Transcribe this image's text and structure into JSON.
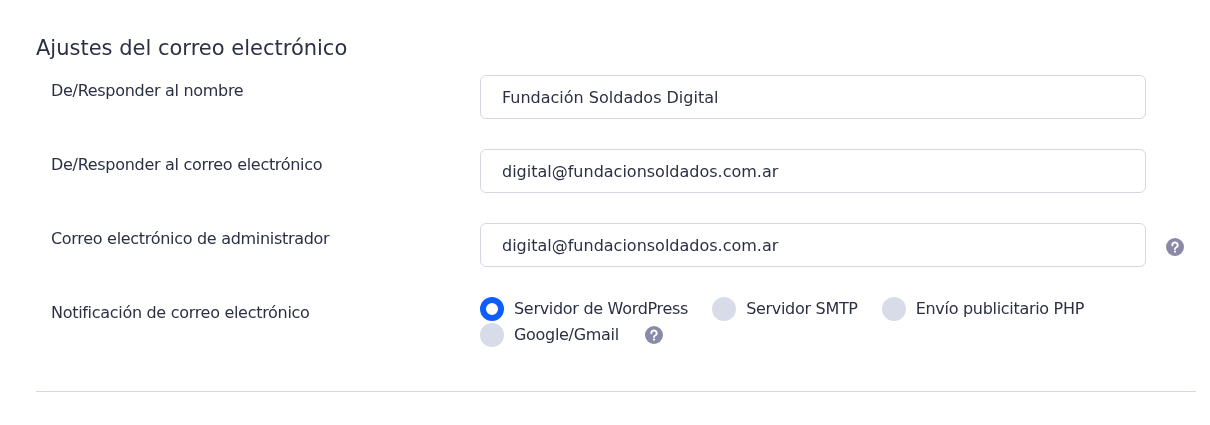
{
  "section": {
    "title": "Ajustes del correo electrónico"
  },
  "fields": [
    {
      "label": "De/Responder al nombre",
      "value": "Fundación Soldados Digital",
      "help": false
    },
    {
      "label": "De/Responder al correo electrónico",
      "value": "digital@fundacionsoldados.com.ar",
      "help": false
    },
    {
      "label": "Correo electrónico de administrador",
      "value": "digital@fundacionsoldados.com.ar",
      "help": true
    }
  ],
  "notification": {
    "label": "Notificación de correo electrónico",
    "help": true,
    "options": [
      {
        "label": "Servidor de WordPress",
        "selected": true
      },
      {
        "label": "Servidor SMTP",
        "selected": false
      },
      {
        "label": "Envío publicitario PHP",
        "selected": false
      },
      {
        "label": "Google/Gmail",
        "selected": false
      }
    ]
  }
}
